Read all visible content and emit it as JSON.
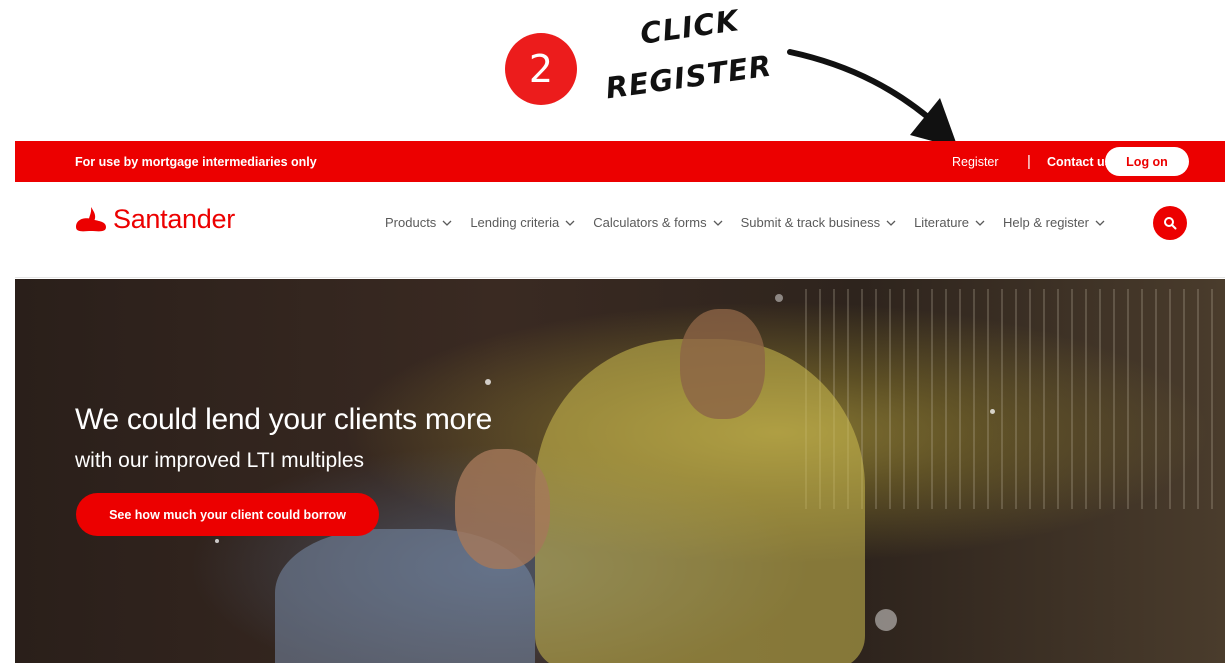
{
  "annotation": {
    "step_number": "2",
    "note_line1": "CLICK",
    "note_line2": "REGISTER"
  },
  "topbar": {
    "notice": "For use by mortgage intermediaries only",
    "register": "Register",
    "divider": "|",
    "contact": "Contact us",
    "logon": "Log on"
  },
  "brand": {
    "name": "Santander",
    "color": "#ec0000"
  },
  "nav": {
    "items": [
      "Products",
      "Lending criteria",
      "Calculators & forms",
      "Submit & track business",
      "Literature",
      "Help & register"
    ],
    "search_icon": "search-icon"
  },
  "hero": {
    "title": "We could lend your clients more",
    "subtitle": "with our improved LTI multiples",
    "cta": "See how much your client could borrow"
  }
}
